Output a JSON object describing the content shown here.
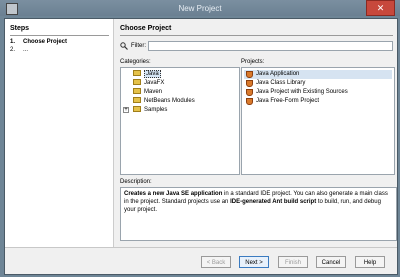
{
  "window": {
    "title": "New Project",
    "close_label": "✕"
  },
  "steps": {
    "title": "Steps",
    "items": [
      {
        "num": "1.",
        "label": "Choose Project"
      },
      {
        "num": "2.",
        "label": "..."
      }
    ]
  },
  "main": {
    "title": "Choose Project",
    "filter_label": "Filter:",
    "filter_value": "",
    "categories_label": "Categories:",
    "projects_label": "Projects:",
    "categories": [
      "Java",
      "JavaFX",
      "Maven",
      "NetBeans Modules",
      "Samples"
    ],
    "selected_category": "Java",
    "projects": [
      "Java Application",
      "Java Class Library",
      "Java Project with Existing Sources",
      "Java Free-Form Project"
    ],
    "selected_project": "Java Application",
    "description_label": "Description:",
    "description": {
      "bold1": "Creates a new Java SE application",
      "text1": " in a standard IDE project. You can also generate a main class in the project. Standard projects use an ",
      "bold2": "IDE-generated Ant build script",
      "text2": " to build, run, and debug your project."
    }
  },
  "buttons": {
    "back": "< Back",
    "next": "Next >",
    "finish": "Finish",
    "cancel": "Cancel",
    "help": "Help"
  }
}
